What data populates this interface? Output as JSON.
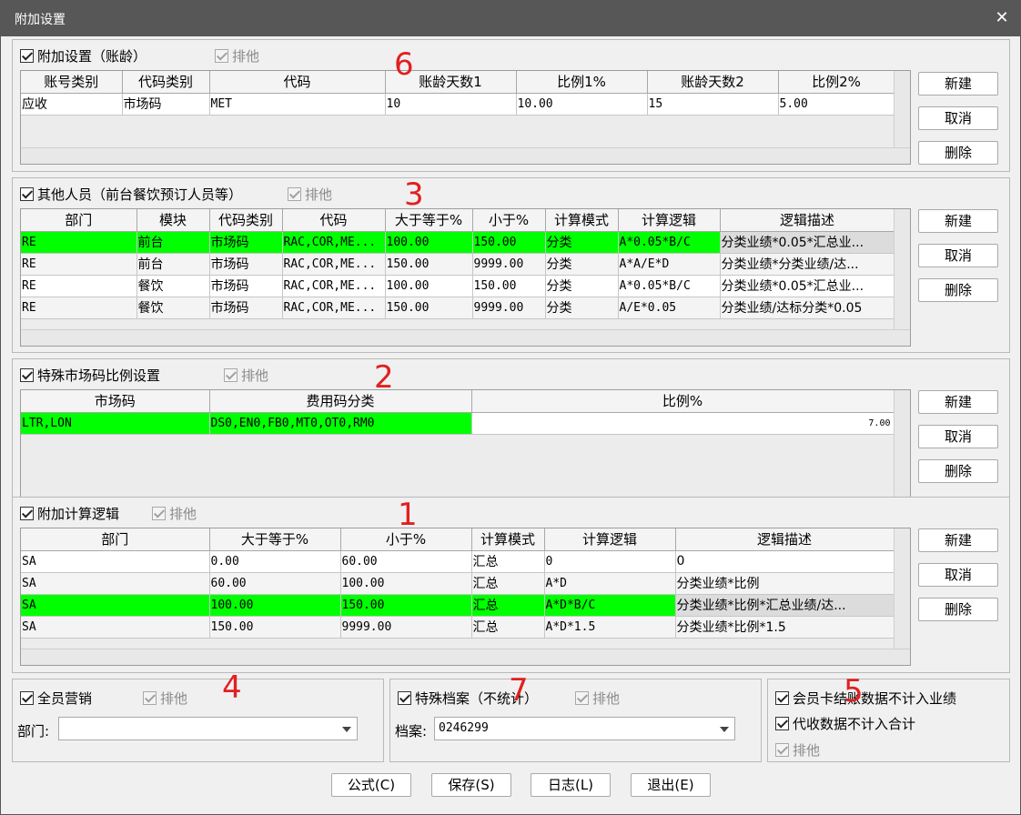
{
  "window": {
    "title": "附加设置",
    "close_glyph": "✕"
  },
  "common": {
    "new": "新建",
    "cancel": "取消",
    "delete": "删除",
    "exclude": "排他"
  },
  "markers": {
    "m1": "1",
    "m2": "2",
    "m3": "3",
    "m4": "4",
    "m5": "5",
    "m6": "6",
    "m7": "7"
  },
  "aging": {
    "title": "附加设置（账龄）",
    "columns": [
      "账号类别",
      "代码类别",
      "代码",
      "账龄天数1",
      "比例1%",
      "账龄天数2",
      "比例2%"
    ],
    "rows": [
      [
        "应收",
        "市场码",
        "MET",
        "10",
        "10.00",
        "15",
        "5.00"
      ]
    ]
  },
  "others": {
    "title": "其他人员（前台餐饮预订人员等）",
    "columns": [
      "部门",
      "模块",
      "代码类别",
      "代码",
      "大于等于%",
      "小于%",
      "计算模式",
      "计算逻辑",
      "逻辑描述"
    ],
    "rows": [
      [
        "RE",
        "前台",
        "市场码",
        "RAC,COR,ME...",
        "100.00",
        "150.00",
        "分类",
        "A*0.05*B/C",
        "分类业绩*0.05*汇总业..."
      ],
      [
        "RE",
        "前台",
        "市场码",
        "RAC,COR,ME...",
        "150.00",
        "9999.00",
        "分类",
        "A*A/E*D",
        "分类业绩*分类业绩/达..."
      ],
      [
        "RE",
        "餐饮",
        "市场码",
        "RAC,COR,ME...",
        "100.00",
        "150.00",
        "分类",
        "A*0.05*B/C",
        "分类业绩*0.05*汇总业..."
      ],
      [
        "RE",
        "餐饮",
        "市场码",
        "RAC,COR,ME...",
        "150.00",
        "9999.00",
        "分类",
        "A/E*0.05",
        "分类业绩/达标分类*0.05"
      ]
    ]
  },
  "market": {
    "title": "特殊市场码比例设置",
    "columns": [
      "市场码",
      "费用码分类",
      "比例%"
    ],
    "rows": [
      [
        "LTR,LON",
        "DS0,EN0,FB0,MT0,OT0,RM0",
        "7.00"
      ]
    ]
  },
  "calc": {
    "title": "附加计算逻辑",
    "columns": [
      "部门",
      "大于等于%",
      "小于%",
      "计算模式",
      "计算逻辑",
      "逻辑描述"
    ],
    "rows": [
      [
        "SA",
        "0.00",
        "60.00",
        "汇总",
        "0",
        "0"
      ],
      [
        "SA",
        "60.00",
        "100.00",
        "汇总",
        "A*D",
        "分类业绩*比例"
      ],
      [
        "SA",
        "100.00",
        "150.00",
        "汇总",
        "A*D*B/C",
        "分类业绩*比例*汇总业绩/达..."
      ],
      [
        "SA",
        "150.00",
        "9999.00",
        "汇总",
        "A*D*1.5",
        "分类业绩*比例*1.5"
      ]
    ]
  },
  "marketing": {
    "title": "全员营销",
    "dept_label": "部门:",
    "dept_value": ""
  },
  "archive": {
    "title": "特殊档案（不统计）",
    "label": "档案:",
    "value": "0246299"
  },
  "flags": {
    "member": "会员卡结账数据不计入业绩",
    "collect": "代收数据不计入合计"
  },
  "footer": {
    "formula": "公式(C)",
    "save": "保存(S)",
    "log": "日志(L)",
    "exit": "退出(E)"
  }
}
